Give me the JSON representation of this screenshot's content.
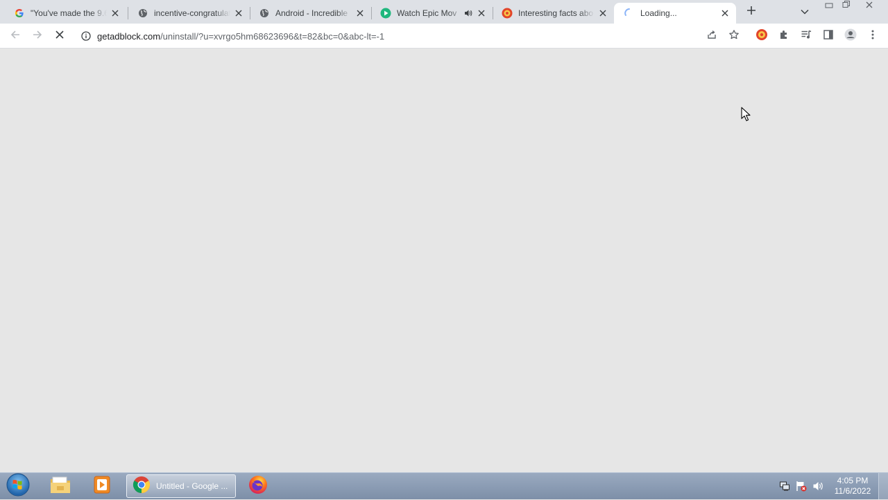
{
  "tabs": [
    {
      "title": "\"You've made the 9.6",
      "icon": "google-g-icon"
    },
    {
      "title": "incentive-congratulat",
      "icon": "globe-icon"
    },
    {
      "title": "Android - Incredible",
      "icon": "globe-icon"
    },
    {
      "title": "Watch Epic Mov",
      "icon": "play-circle-icon",
      "audio": true
    },
    {
      "title": "Interesting facts abo",
      "icon": "red-site-icon"
    },
    {
      "title": "Loading...",
      "icon": "loading-spinner-icon",
      "active": true
    }
  ],
  "address_bar": {
    "host": "getadblock.com",
    "path": "/uninstall/?u=xvrgo5hm68623696&t=82&bc=0&abc-lt=-1"
  },
  "taskbar": {
    "chrome_label": "Untitled - Google ...",
    "time": "4:05 PM",
    "date": "11/6/2022"
  },
  "colors": {
    "tabstrip": "#dee1e6",
    "content_bg": "#e6e6e6",
    "taskbar": "#8a9bb3"
  }
}
